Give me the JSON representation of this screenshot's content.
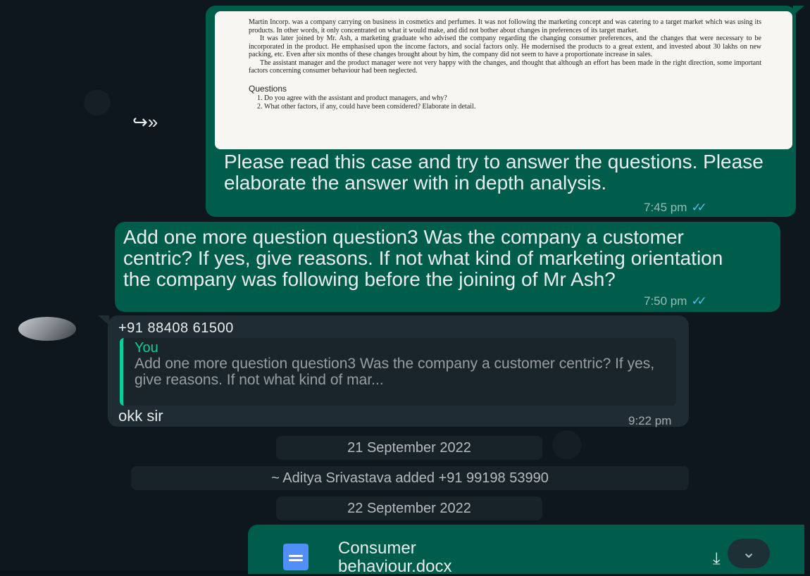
{
  "forward_icon": "forward-icon",
  "case_document": {
    "para1": "Martin Incorp. was a company carrying on business in cosmetics and perfumes. It was not following the marketing concept and was catering to a target market which was using its products. In other words, it only concentrated on what it would make, and did not bother about changes in preferences of its target market.",
    "para2": "It was later joined by Mr. Ash, a marketing graduate who advised the company regarding the changing consumer preferences, and the changes that were necessary to be incorporated in the product. He emphasised upon the income factors, and social factors only. He modernised the products to a great extent, and invested about 30 lakhs on new packing, etc. Even after six months of these changes brought about by him, the company did not seem to have a proportionate increase in sales.",
    "para3": "The assistant manager and the product manager were not very happy with the changes, and thought that although an effort has been made in the right direction, some important factors concerning consumer behaviour had been neglected.",
    "questions_heading": "Questions",
    "q1": "Do you agree with the assistant and product managers, and why?",
    "q2": "What other factors, if any, could have been considered? Elaborate in detail."
  },
  "message1": {
    "text": "Please read this case and try to answer the questions. Please elaborate the answer with in depth analysis.",
    "time": "7:45 pm",
    "ticks": "✓✓"
  },
  "message2": {
    "text": "Add one more question question3 Was the company a customer centric? If yes, give reasons. If not what kind of marketing orientation the company was following before the joining of Mr Ash?",
    "time": "7:50 pm",
    "ticks": "✓✓"
  },
  "message3": {
    "sender": "+91 88408 61500",
    "quote_author": "You",
    "quote_text": "Add one more question question3 Was the company a customer centric? If yes, give reasons. If not what kind of mar...",
    "text": "okk sir",
    "time": "9:22 pm"
  },
  "date1": "21 September 2022",
  "system_notice": "~ Aditya Srivastava added +91 99198 53990",
  "date2": "22 September 2022",
  "document_message": {
    "filename_line1": "Consumer",
    "filename_line2": "behaviour.docx",
    "download_icon": "download-icon"
  },
  "scroll_down_icon": "double-chevron-down-icon",
  "colors": {
    "outgoing_bubble": "#005c4b",
    "incoming_bubble": "#202c33",
    "read_ticks": "#53bdeb",
    "quote_accent": "#06cf9c",
    "doc_icon": "#4f8ff7"
  }
}
